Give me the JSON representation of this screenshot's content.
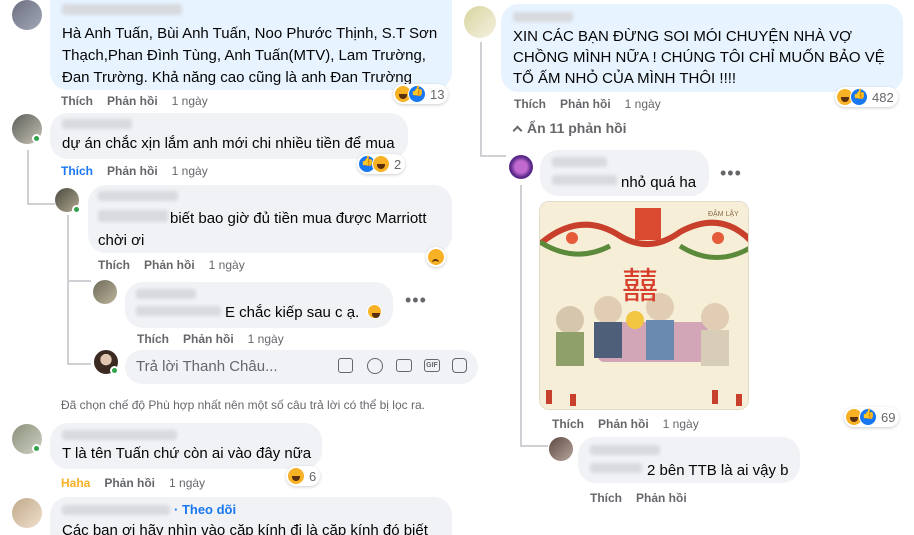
{
  "left": {
    "c1": {
      "text": "Hà Anh Tuấn, Bùi Anh Tuấn, Noo Phước Thịnh, S.T Sơn Thạch,Phan Đình Tùng, Anh Tuấn(MTV), Lam Trường, Đan Trường. Khả năng cao cũng là anh Đan Trường",
      "like": "Thích",
      "reply": "Phản hồi",
      "time": "1 ngày",
      "count": "13"
    },
    "c2": {
      "text": "dự án chắc xịn lắm anh mới chi nhiều tiền để mua",
      "like": "Thích",
      "reply": "Phản hồi",
      "time": "1 ngày",
      "count": "2"
    },
    "c3": {
      "text": "biết bao giờ đủ tiền mua được Marriott chời ơi",
      "like": "Thích",
      "reply": "Phản hồi",
      "time": "1 ngày"
    },
    "c4": {
      "text": "E chắc kiếp sau c ạ.",
      "like": "Thích",
      "reply": "Phản hồi",
      "time": "1 ngày"
    },
    "reply_box": {
      "placeholder": "Trả lời Thanh Châu..."
    },
    "filter_note": "Đã chọn chế độ Phù hợp nhất nên một số câu trả lời có thể bị lọc ra.",
    "c5": {
      "text": "T là tên Tuấn chứ còn ai vào đây nữa",
      "like": "Haha",
      "reply": "Phản hồi",
      "time": "1 ngày",
      "count": "6"
    },
    "c6": {
      "follow": "· Theo dõi",
      "text": "Các bạn ơi hãy nhìn vào cặp kính đi là cặp kính đó biết"
    }
  },
  "right": {
    "c1": {
      "text": "XIN CÁC BẠN ĐỪNG SOI MÓI CHUYỆN NHÀ VỢ CHỒNG MÌNH NỮA ! CHÚNG TÔI CHỈ MUỐN BẢO VỆ TỔ ẤM NHỎ CỦA MÌNH THÔI !!!!",
      "like": "Thích",
      "reply": "Phản hồi",
      "time": "1 ngày",
      "count": "482"
    },
    "hide_replies": "Ẩn 11 phản hồi",
    "c2": {
      "text": "nhỏ quá ha",
      "like": "Thích",
      "reply": "Phản hồi",
      "time": "1 ngày",
      "count": "69"
    },
    "c3": {
      "text": "2 bên TTB là ai vậy b",
      "like": "Thích",
      "reply": "Phản hồi"
    },
    "image_logo": "ĐẬM LẬY",
    "image_glyph": "囍"
  },
  "colors": {
    "blue_bubble": "#e7f3ff",
    "gray_bubble": "#f0f2f5",
    "link": "#1877f2",
    "haha": "#f7b125"
  }
}
